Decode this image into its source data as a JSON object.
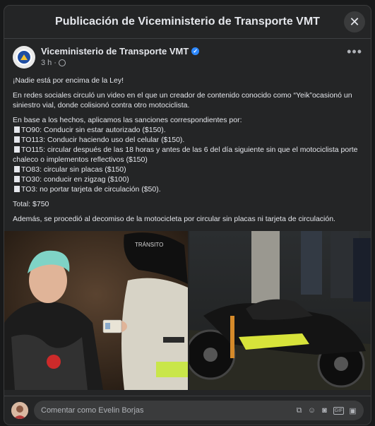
{
  "modal": {
    "title": "Publicación de Viceministerio de Transporte VMT",
    "close_icon": "close-icon"
  },
  "post": {
    "author": "Viceministerio de Transporte VMT",
    "time": "3 h",
    "privacy_icon": "globe-icon",
    "more_icon": "more-icon",
    "text": {
      "headline": "¡Nadie está por encima de la Ley!",
      "para1": "En redes sociales circuló un video en el que un creador de contenido conocido como “Yeik”ocasionó un siniestro vial, donde colisionó contra otro motociclista.",
      "intro": "En base a los hechos, aplicamos las sanciones correspondientes por:",
      "sanctions": [
        "TO90: Conducir sin estar autorizado ($150).",
        "TO113: Conducir haciendo uso del celular ($150).",
        "TO115: circular después de las 18 horas y antes de las 6 del día siguiente sin que el motociclista porte chaleco o implementos reflectivos ($150)",
        "TO83: circular sin placas ($150)",
        "TO30: conducir en zigzag ($100)",
        "TO3: no portar tarjeta de circulación ($50)."
      ],
      "total": "Total: $750",
      "closing": "Además, se procedió al decomiso de la motocicleta por circular sin placas ni tarjeta de circulación."
    },
    "photo_left_text": "TRÁNSITO"
  },
  "comment": {
    "placeholder": "Comentar como Evelin Borjas",
    "icons": [
      "sticker-icon",
      "emoji-icon",
      "camera-icon",
      "gif-icon",
      "sticker-alt-icon"
    ]
  }
}
